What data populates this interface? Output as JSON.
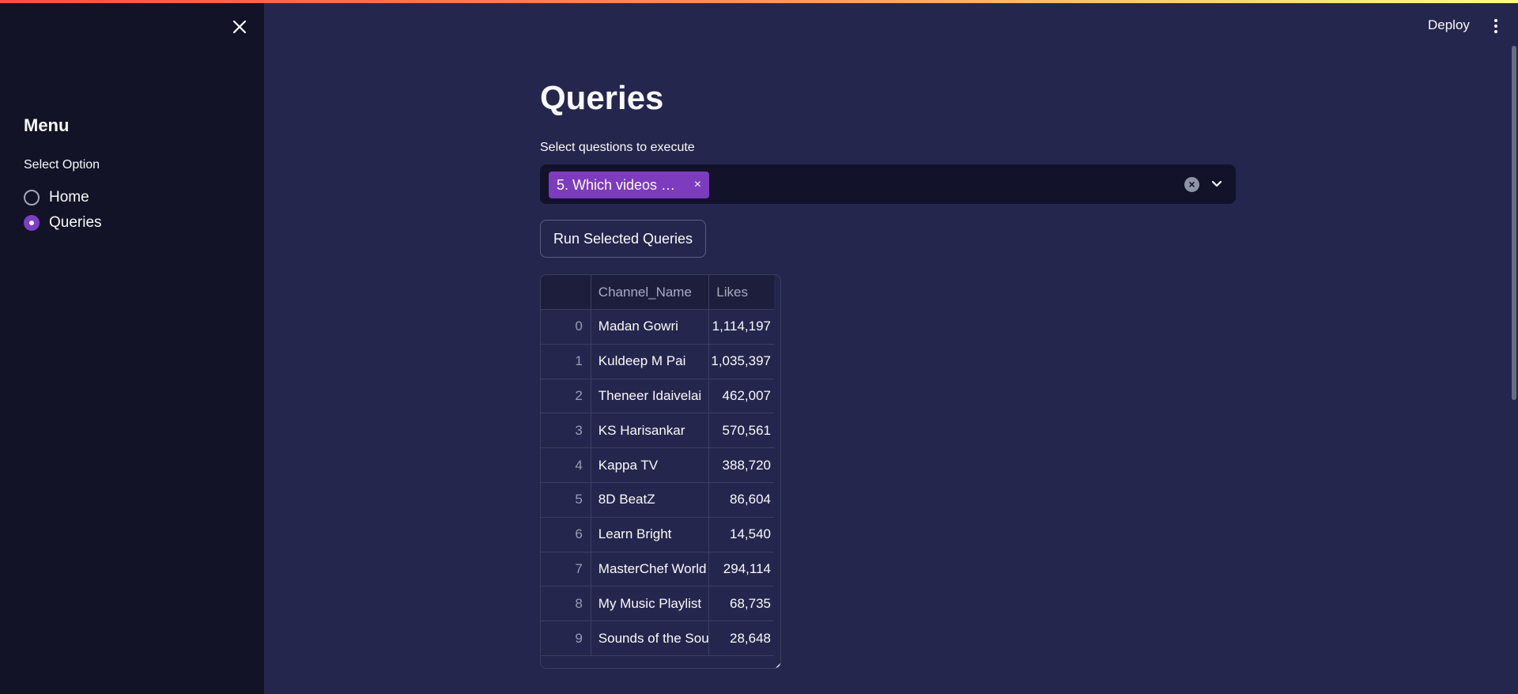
{
  "sidebar": {
    "title": "Menu",
    "radio_label": "Select Option",
    "options": [
      {
        "label": "Home",
        "selected": false
      },
      {
        "label": "Queries",
        "selected": true
      }
    ]
  },
  "header": {
    "deploy_label": "Deploy"
  },
  "main": {
    "title": "Queries",
    "multiselect": {
      "label": "Select questions to execute",
      "selected_chip": "5. Which videos …",
      "chip_remove": "×"
    },
    "run_button": "Run Selected Queries",
    "table": {
      "columns": [
        "",
        "Channel_Name",
        "Likes"
      ],
      "rows": [
        {
          "index": "0",
          "channel": "Madan Gowri",
          "likes": "1,114,197"
        },
        {
          "index": "1",
          "channel": "Kuldeep M Pai",
          "likes": "1,035,397"
        },
        {
          "index": "2",
          "channel": "Theneer Idaivelai",
          "likes": "462,007"
        },
        {
          "index": "3",
          "channel": "KS Harisankar",
          "likes": "570,561"
        },
        {
          "index": "4",
          "channel": "Kappa TV",
          "likes": "388,720"
        },
        {
          "index": "5",
          "channel": "8D BeatZ",
          "likes": "86,604"
        },
        {
          "index": "6",
          "channel": "Learn Bright",
          "likes": "14,540"
        },
        {
          "index": "7",
          "channel": "MasterChef World",
          "likes": "294,114"
        },
        {
          "index": "8",
          "channel": "My Music Playlist",
          "likes": "68,735"
        },
        {
          "index": "9",
          "channel": "Sounds of the Soul",
          "likes": "28,648"
        }
      ]
    }
  },
  "colors": {
    "background": "#25264d",
    "sidebar": "#121327",
    "accent": "#7d3bbd"
  }
}
